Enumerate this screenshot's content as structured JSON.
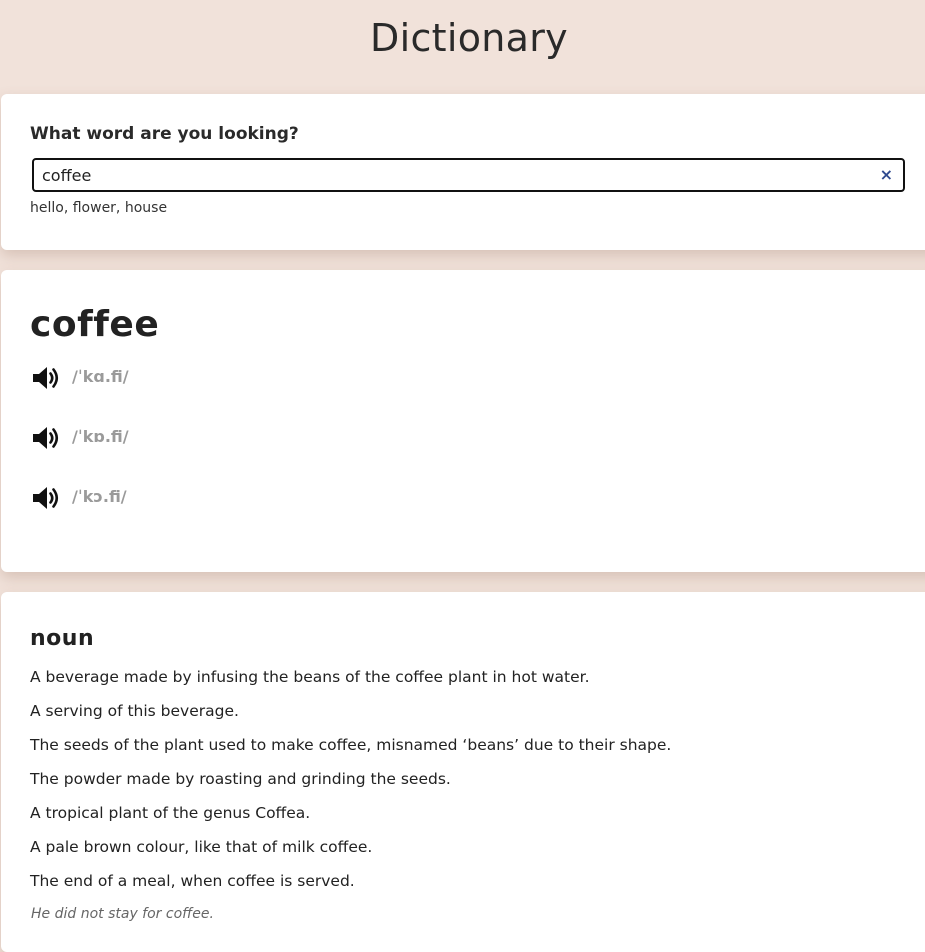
{
  "header": {
    "title": "Dictionary"
  },
  "search": {
    "label": "What word are you looking?",
    "value": "coffee",
    "clear_icon": "×",
    "suggestions": "hello, flower, house"
  },
  "entry": {
    "word": "coffee",
    "phonetics": [
      {
        "text": "/ˈkɑ.fi/",
        "icon": "speaker-icon"
      },
      {
        "text": "/ˈkɒ.fi/",
        "icon": "speaker-icon"
      },
      {
        "text": "/ˈkɔ.fi/",
        "icon": "speaker-icon"
      }
    ]
  },
  "meaning": {
    "part_of_speech": "noun",
    "definitions": [
      "A beverage made by infusing the beans of the coffee plant in hot water.",
      "A serving of this beverage.",
      "The seeds of the plant used to make coffee, misnamed ‘beans’ due to their shape.",
      "The powder made by roasting and grinding the seeds.",
      "A tropical plant of the genus Coffea.",
      "A pale brown colour, like that of milk coffee.",
      "The end of a meal, when coffee is served."
    ],
    "example": "He did not stay for coffee."
  },
  "colors": {
    "background": "#f1e2da",
    "card": "#ffffff",
    "accent": "#2f4a8f",
    "phonetic_text": "#9a9a9a"
  }
}
